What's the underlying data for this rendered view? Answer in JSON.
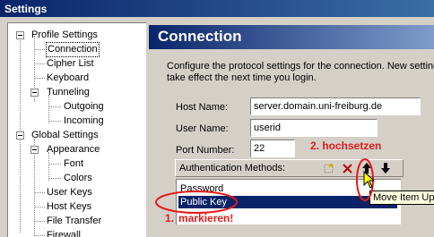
{
  "window": {
    "title": "Settings"
  },
  "tree": [
    {
      "label": "Profile Settings"
    },
    {
      "label": "Connection"
    },
    {
      "label": "Cipher List"
    },
    {
      "label": "Keyboard"
    },
    {
      "label": "Tunneling"
    },
    {
      "label": "Outgoing"
    },
    {
      "label": "Incoming"
    },
    {
      "label": "Global Settings"
    },
    {
      "label": "Appearance"
    },
    {
      "label": "Font"
    },
    {
      "label": "Colors"
    },
    {
      "label": "User Keys"
    },
    {
      "label": "Host Keys"
    },
    {
      "label": "File Transfer"
    },
    {
      "label": "Firewall"
    }
  ],
  "panel": {
    "title": "Connection",
    "desc_line1": "Configure the protocol settings for the connection. New settings",
    "desc_line2": "take effect the next time you login.",
    "host_label": "Host Name:",
    "host_value": "server.domain.uni-freiburg.de",
    "user_label": "User Name:",
    "user_value": "userid",
    "port_label": "Port Number:",
    "port_value": "22",
    "auth_label": "Authentication Methods:",
    "auth_items": [
      "Password",
      "Public Key"
    ],
    "tooltip": "Move Item Up"
  },
  "annotations": {
    "step2": "2. hochsetzen",
    "step1a": "1.",
    "step1b": "markieren!"
  },
  "colors": {
    "annotation": "#e41b1b",
    "selection": "#0a246a",
    "tooltip_bg": "#ffffe1"
  },
  "icons": [
    "new-item-icon",
    "delete-icon",
    "move-up-icon",
    "move-down-icon",
    "cursor-icon"
  ]
}
